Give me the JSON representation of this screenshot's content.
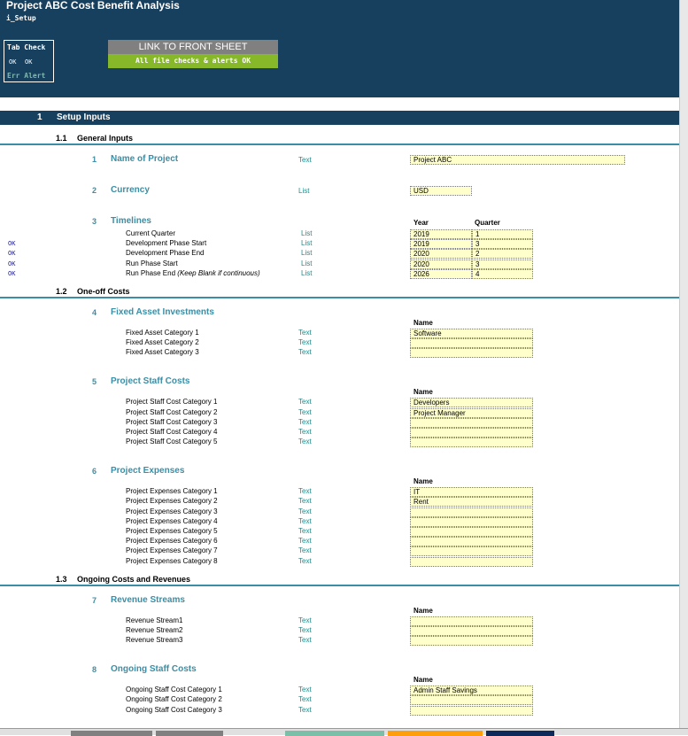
{
  "header": {
    "title": "Project ABC Cost Benefit Analysis",
    "sheet": "i_Setup",
    "tab_check": {
      "title": "Tab Check",
      "ok1": "OK",
      "ok2": "OK",
      "err": "Err Alert"
    },
    "link_button": "LINK TO FRONT SHEET",
    "checks_status": "All file checks & alerts OK"
  },
  "section": {
    "number": "1",
    "label": "Setup Inputs"
  },
  "subsections": [
    {
      "number": "1.1",
      "label": "General Inputs",
      "items": [
        {
          "number": "1",
          "title": "Name of Project",
          "type": "Text",
          "value": "Project ABC",
          "kind": "wide"
        },
        {
          "number": "2",
          "title": "Currency",
          "type": "List",
          "value": "USD",
          "kind": "narrow"
        },
        {
          "number": "3",
          "title": "Timelines",
          "kind": "timeline",
          "col_headers": [
            "Year",
            "Quarter"
          ],
          "rows": [
            {
              "label": "Current Quarter",
              "type": "List",
              "check": "",
              "year": "2019",
              "quarter": "1"
            },
            {
              "label": "Development Phase Start",
              "type": "List",
              "check": "OK",
              "year": "2019",
              "quarter": "3"
            },
            {
              "label": "Development Phase End",
              "type": "List",
              "check": "OK",
              "year": "2020",
              "quarter": "2"
            },
            {
              "label": "Run Phase Start",
              "type": "List",
              "check": "OK",
              "year": "2020",
              "quarter": "3"
            },
            {
              "label": "Run Phase End",
              "note": "(Keep Blank if continuous)",
              "type": "List",
              "check": "OK",
              "year": "2026",
              "quarter": "4"
            }
          ]
        }
      ]
    },
    {
      "number": "1.2",
      "label": "One-off Costs",
      "items": [
        {
          "number": "4",
          "title": "Fixed Asset Investments",
          "kind": "names",
          "col_header": "Name",
          "rows": [
            {
              "label": "Fixed Asset Category 1",
              "type": "Text",
              "value": "Software"
            },
            {
              "label": "Fixed Asset Category 2",
              "type": "Text",
              "value": ""
            },
            {
              "label": "Fixed Asset Category 3",
              "type": "Text",
              "value": ""
            }
          ]
        },
        {
          "number": "5",
          "title": "Project Staff Costs",
          "kind": "names",
          "col_header": "Name",
          "rows": [
            {
              "label": "Project Staff Cost Category 1",
              "type": "Text",
              "value": "Developers"
            },
            {
              "label": "Project Staff Cost Category 2",
              "type": "Text",
              "value": "Project Manager"
            },
            {
              "label": "Project Staff Cost Category 3",
              "type": "Text",
              "value": ""
            },
            {
              "label": "Project Staff Cost Category 4",
              "type": "Text",
              "value": ""
            },
            {
              "label": "Project Staff Cost Category 5",
              "type": "Text",
              "value": ""
            }
          ]
        },
        {
          "number": "6",
          "title": "Project Expenses",
          "kind": "names",
          "col_header": "Name",
          "rows": [
            {
              "label": "Project Expenses Category 1",
              "type": "Text",
              "value": "IT"
            },
            {
              "label": "Project Expenses Category 2",
              "type": "Text",
              "value": "Rent"
            },
            {
              "label": "Project Expenses Category 3",
              "type": "Text",
              "value": ""
            },
            {
              "label": "Project Expenses Category 4",
              "type": "Text",
              "value": ""
            },
            {
              "label": "Project Expenses Category 5",
              "type": "Text",
              "value": ""
            },
            {
              "label": "Project Expenses Category 6",
              "type": "Text",
              "value": ""
            },
            {
              "label": "Project Expenses Category 7",
              "type": "Text",
              "value": ""
            },
            {
              "label": "Project Expenses Category 8",
              "type": "Text",
              "value": ""
            }
          ]
        }
      ]
    },
    {
      "number": "1.3",
      "label": "Ongoing Costs and Revenues",
      "items": [
        {
          "number": "7",
          "title": "Revenue Streams",
          "kind": "names",
          "col_header": "Name",
          "rows": [
            {
              "label": "Revenue Stream1",
              "type": "Text",
              "value": ""
            },
            {
              "label": "Revenue Stream2",
              "type": "Text",
              "value": ""
            },
            {
              "label": "Revenue Stream3",
              "type": "Text",
              "value": ""
            }
          ]
        },
        {
          "number": "8",
          "title": "Ongoing Staff Costs",
          "kind": "names",
          "col_header": "Name",
          "rows": [
            {
              "label": "Ongoing Staff Cost Category 1",
              "type": "Text",
              "value": "Admin Staff Savings"
            },
            {
              "label": "Ongoing Staff Cost Category 2",
              "type": "Text",
              "value": ""
            },
            {
              "label": "Ongoing Staff Cost Category 3",
              "type": "Text",
              "value": ""
            }
          ]
        }
      ]
    }
  ],
  "colors": {
    "header_bg": "#17405f",
    "accent": "#3b8ea5",
    "input_bg": "#ffffcc",
    "status_green": "#86b82a",
    "link_gray": "#808080"
  },
  "sheet_tab_colors": [
    "#808080",
    "#808080",
    "#7bbfa8",
    "#ff9e0c",
    "#0d2a5a"
  ]
}
